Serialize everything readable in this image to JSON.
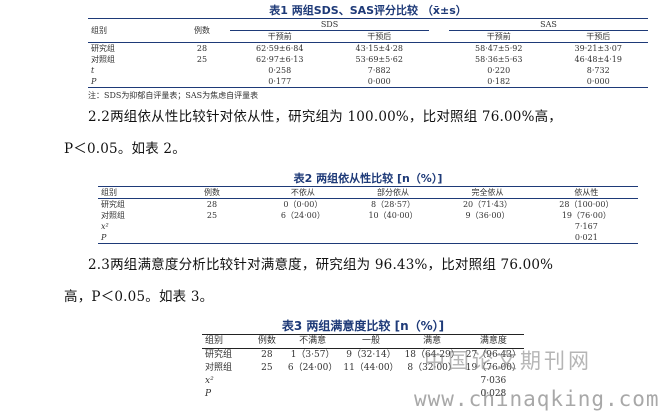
{
  "table1": {
    "caption_prefix": "表1",
    "caption_title": "两组SDS、SAS评分比较",
    "caption_unit": "（x̄±s）",
    "headers": {
      "group": "组别",
      "cases": "例数",
      "sds": "SDS",
      "sas": "SAS",
      "before": "干预前",
      "after": "干预后"
    },
    "rows": [
      {
        "label": "研究组",
        "n": "28",
        "sds_before": "62·59±6·84",
        "sds_after": "43·15±4·28",
        "sas_before": "58·47±5·92",
        "sas_after": "39·21±3·07"
      },
      {
        "label": "对照组",
        "n": "25",
        "sds_before": "62·97±6·13",
        "sds_after": "53·69±5·62",
        "sas_before": "58·36±5·63",
        "sas_after": "46·48±4·19"
      },
      {
        "label": "t",
        "n": "",
        "sds_before": "0·258",
        "sds_after": "7·882",
        "sas_before": "0·220",
        "sas_after": "8·732"
      },
      {
        "label": "P",
        "n": "",
        "sds_before": "0·177",
        "sds_after": "0·000",
        "sas_before": "0·182",
        "sas_after": "0·000"
      }
    ],
    "note": "注：SDS为抑郁自评量表；SAS为焦虑自评量表"
  },
  "para1": {
    "line1": "2.2两组依从性比较针对依从性，研究组为 100.00%，比对照组 76.00%高，",
    "line2": "P＜0.05。如表 2。"
  },
  "table2": {
    "caption_prefix": "表2",
    "caption_title": "两组依从性比较",
    "caption_unit": "[n（%）]",
    "headers": [
      "组别",
      "例数",
      "不依从",
      "部分依从",
      "完全依从",
      "依从性"
    ],
    "rows": [
      [
        "研究组",
        "28",
        "0（0·00）",
        "8（28·57）",
        "20（71·43）",
        "28（100·00）"
      ],
      [
        "对照组",
        "25",
        "6（24·00）",
        "10（40·00）",
        "9（36·00）",
        "19（76·00）"
      ],
      [
        "x²",
        "",
        "",
        "",
        "",
        "7·167"
      ],
      [
        "P",
        "",
        "",
        "",
        "",
        "0·021"
      ]
    ]
  },
  "para2": {
    "line1": "2.3两组满意度分析比较针对满意度，研究组为 96.43%，比对照组 76.00%",
    "line2": "高，P＜0.05。如表 3。"
  },
  "table3": {
    "caption_prefix": "表3",
    "caption_title": "两组满意度比较",
    "caption_unit": "[n（%）]",
    "headers": [
      "组别",
      "例数",
      "不满意",
      "一般",
      "满意",
      "满意度"
    ],
    "rows": [
      [
        "研究组",
        "28",
        "1（3·57）",
        "9（32·14）",
        "18（64·29）",
        "27（96·43）"
      ],
      [
        "对照组",
        "25",
        "6（24·00）",
        "11（44·00）",
        "8（32·00）",
        "19（76·00）"
      ],
      [
        "x²",
        "",
        "",
        "",
        "",
        "7·036"
      ],
      [
        "P",
        "",
        "",
        "",
        "",
        "0·028"
      ]
    ]
  },
  "watermark": {
    "line1": "中国论文期刊网",
    "line2": "www.chinaqking.com"
  }
}
